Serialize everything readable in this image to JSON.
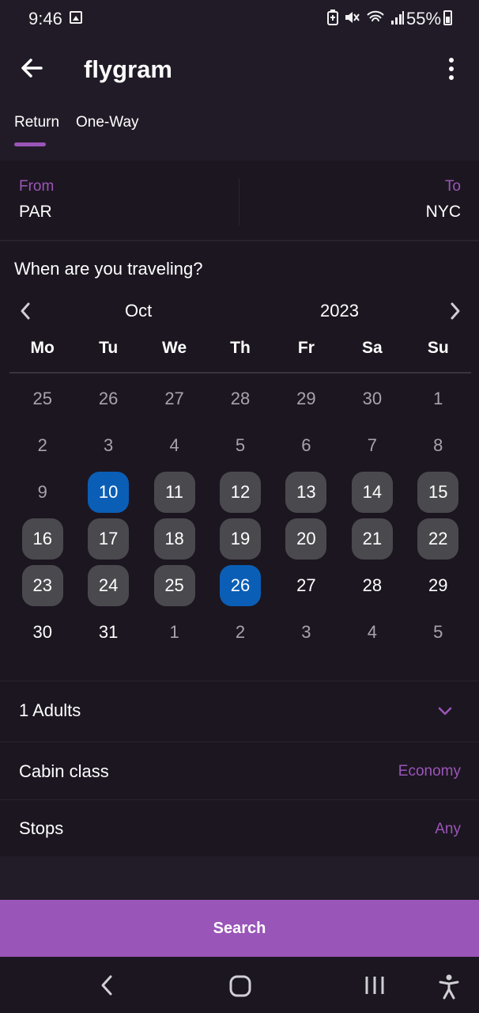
{
  "status": {
    "time": "9:46",
    "battery": "55%",
    "icons": [
      "image-icon",
      "battery-saver-icon",
      "mute-icon",
      "wifi-icon",
      "signal-icon"
    ]
  },
  "app": {
    "title": "flygram"
  },
  "tabs": [
    {
      "label": "Return",
      "active": true
    },
    {
      "label": "One-Way",
      "active": false
    }
  ],
  "route": {
    "from_label": "From",
    "from_value": "PAR",
    "to_label": "To",
    "to_value": "NYC"
  },
  "calendar": {
    "question": "When are you traveling?",
    "month": "Oct",
    "year": "2023",
    "weekdays": [
      "Mo",
      "Tu",
      "We",
      "Th",
      "Fr",
      "Sa",
      "Su"
    ],
    "days": [
      {
        "d": "25",
        "s": "muted"
      },
      {
        "d": "26",
        "s": "muted"
      },
      {
        "d": "27",
        "s": "muted"
      },
      {
        "d": "28",
        "s": "muted"
      },
      {
        "d": "29",
        "s": "muted"
      },
      {
        "d": "30",
        "s": "muted"
      },
      {
        "d": "1",
        "s": "muted"
      },
      {
        "d": "2",
        "s": "muted"
      },
      {
        "d": "3",
        "s": "muted"
      },
      {
        "d": "4",
        "s": "muted"
      },
      {
        "d": "5",
        "s": "muted"
      },
      {
        "d": "6",
        "s": "muted"
      },
      {
        "d": "7",
        "s": "muted"
      },
      {
        "d": "8",
        "s": "muted"
      },
      {
        "d": "9",
        "s": "muted"
      },
      {
        "d": "10",
        "s": "selected"
      },
      {
        "d": "11",
        "s": "range"
      },
      {
        "d": "12",
        "s": "range"
      },
      {
        "d": "13",
        "s": "range"
      },
      {
        "d": "14",
        "s": "range"
      },
      {
        "d": "15",
        "s": "range"
      },
      {
        "d": "16",
        "s": "range"
      },
      {
        "d": "17",
        "s": "range"
      },
      {
        "d": "18",
        "s": "range"
      },
      {
        "d": "19",
        "s": "range"
      },
      {
        "d": "20",
        "s": "range"
      },
      {
        "d": "21",
        "s": "range"
      },
      {
        "d": "22",
        "s": "range"
      },
      {
        "d": "23",
        "s": "range"
      },
      {
        "d": "24",
        "s": "range"
      },
      {
        "d": "25",
        "s": "range"
      },
      {
        "d": "26",
        "s": "selected"
      },
      {
        "d": "27",
        "s": "normal"
      },
      {
        "d": "28",
        "s": "normal"
      },
      {
        "d": "29",
        "s": "normal"
      },
      {
        "d": "30",
        "s": "normal"
      },
      {
        "d": "31",
        "s": "normal"
      },
      {
        "d": "1",
        "s": "muted"
      },
      {
        "d": "2",
        "s": "muted"
      },
      {
        "d": "3",
        "s": "muted"
      },
      {
        "d": "4",
        "s": "muted"
      },
      {
        "d": "5",
        "s": "muted"
      }
    ]
  },
  "options": {
    "passengers": "1 Adults",
    "cabin_label": "Cabin class",
    "cabin_value": "Economy",
    "stops_label": "Stops",
    "stops_value": "Any"
  },
  "search": {
    "label": "Search"
  },
  "colors": {
    "accent": "#9a55b8",
    "selected": "#0a5eb5",
    "range": "#4a4a4e",
    "background": "#1c1620"
  }
}
